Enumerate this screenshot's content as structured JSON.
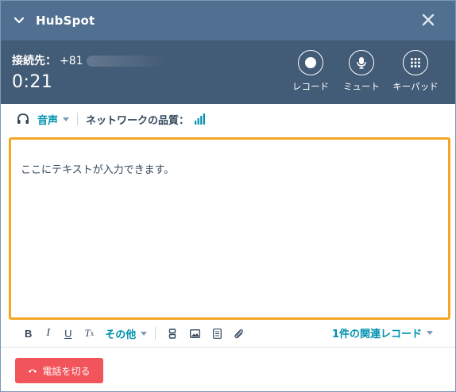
{
  "app": {
    "title": "HubSpot"
  },
  "call": {
    "connected_label": "接続先：",
    "phone_prefix": "+81",
    "timer": "0:21",
    "controls": [
      {
        "label": "レコード",
        "icon": "record-icon"
      },
      {
        "label": "ミュート",
        "icon": "microphone-icon"
      },
      {
        "label": "キーパッド",
        "icon": "keypad-icon"
      }
    ]
  },
  "info": {
    "audio_label": "音声",
    "network_quality_label": "ネットワークの品質："
  },
  "notes": {
    "placeholder": "ここにテキストが入力できます。"
  },
  "toolbar": {
    "bold": "B",
    "italic": "I",
    "underline": "U",
    "clear_format": "T",
    "clear_format_sub": "x",
    "more_label": "その他",
    "related_records": "1件の関連レコード"
  },
  "hangup": {
    "label": "電話を切る"
  },
  "colors": {
    "titlebar": "#516f90",
    "callpanel": "#425b76",
    "accent": "#0091ae",
    "focus_border": "#f5a623",
    "hangup": "#f2545b"
  }
}
